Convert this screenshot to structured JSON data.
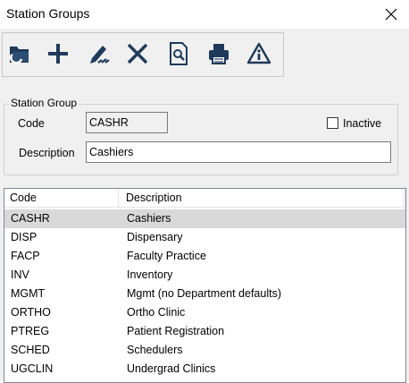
{
  "window": {
    "title": "Station Groups"
  },
  "toolbar": {
    "buttons": [
      {
        "name": "open-folder-icon"
      },
      {
        "name": "add-icon"
      },
      {
        "name": "edit-icon"
      },
      {
        "name": "delete-icon"
      },
      {
        "name": "preview-icon"
      },
      {
        "name": "print-icon"
      },
      {
        "name": "warning-icon"
      }
    ]
  },
  "form": {
    "group_label": "Station Group",
    "code_label": "Code",
    "code_value": "CASHR",
    "inactive_label": "Inactive",
    "inactive_checked": false,
    "description_label": "Description",
    "description_value": "Cashiers"
  },
  "grid": {
    "columns": [
      "Code",
      "Description"
    ],
    "selected_index": 0,
    "rows": [
      {
        "code": "CASHR",
        "description": "Cashiers"
      },
      {
        "code": "DISP",
        "description": "Dispensary"
      },
      {
        "code": "FACP",
        "description": "Faculty Practice"
      },
      {
        "code": "INV",
        "description": "Inventory"
      },
      {
        "code": "MGMT",
        "description": "Mgmt  (no Department defaults)"
      },
      {
        "code": "ORTHO",
        "description": "Ortho Clinic"
      },
      {
        "code": "PTREG",
        "description": "Patient Registration"
      },
      {
        "code": "SCHED",
        "description": "Schedulers"
      },
      {
        "code": "UGCLIN",
        "description": "Undergrad Clinics"
      }
    ]
  }
}
